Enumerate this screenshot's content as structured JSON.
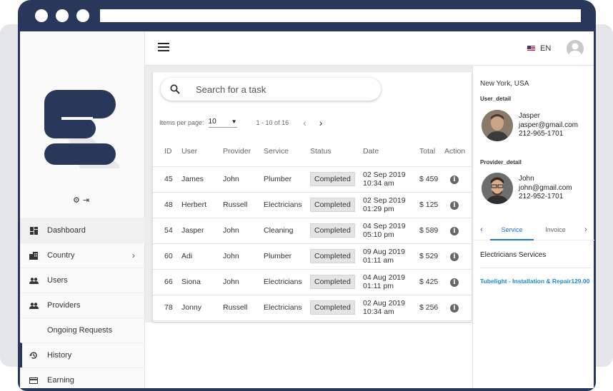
{
  "header": {
    "language": "EN"
  },
  "sidebar": {
    "items": [
      {
        "label": "Dashboard",
        "icon": "dashboard-icon"
      },
      {
        "label": "Country",
        "icon": "building-icon",
        "expandable": true
      },
      {
        "label": "Users",
        "icon": "people-icon"
      },
      {
        "label": "Providers",
        "icon": "people-icon"
      },
      {
        "label": "Ongoing Requests",
        "icon": ""
      },
      {
        "label": "History",
        "icon": "history-icon"
      },
      {
        "label": "Earning",
        "icon": "card-icon"
      }
    ]
  },
  "search": {
    "placeholder": "Search for a task"
  },
  "pager": {
    "items_per_page_label": "Items per page:",
    "per_page": "10",
    "range": "1 - 10 of 16"
  },
  "table": {
    "headers": [
      "ID",
      "User",
      "Provider",
      "Service",
      "Status",
      "Date",
      "Total",
      "Action"
    ],
    "rows": [
      {
        "id": "45",
        "user": "James",
        "provider": "John",
        "service": "Plumber",
        "status": "Completed",
        "date": "02 Sep 2019",
        "time": "10:34 am",
        "total": "$ 459"
      },
      {
        "id": "48",
        "user": "Herbert",
        "provider": "Russell",
        "service": "Electricians",
        "status": "Completed",
        "date": "02 Sep 2019",
        "time": "01:29 pm",
        "total": "$ 125"
      },
      {
        "id": "54",
        "user": "Jasper",
        "provider": "John",
        "service": "Cleaning",
        "status": "Completed",
        "date": "04 Sep 2019",
        "time": "05:10 pm",
        "total": "$ 589"
      },
      {
        "id": "60",
        "user": "Adi",
        "provider": "John",
        "service": "Plumber",
        "status": "Completed",
        "date": "09 Aug 2019",
        "time": "01:11 am",
        "total": "$ 529"
      },
      {
        "id": "66",
        "user": "Siona",
        "provider": "John",
        "service": "Electricians",
        "status": "Completed",
        "date": "04 Aug 2019",
        "time": "01:11 pm",
        "total": "$ 425"
      },
      {
        "id": "78",
        "user": "Jonny",
        "provider": "Russell",
        "service": "Electricians",
        "status": "Completed",
        "date": "02 Aug 2019",
        "time": "10:34 am",
        "total": "$ 256"
      }
    ]
  },
  "detail": {
    "location": "New York, USA",
    "user_label": "User_detail",
    "user": {
      "name": "Jasper",
      "email": "jasper@gmail.com",
      "phone": "212-965-1701"
    },
    "provider_label": "Provider_detail",
    "provider": {
      "name": "John",
      "email": "john@gmail.com",
      "phone": "212-952-1701"
    },
    "tabs": [
      "Service",
      "Invoice"
    ],
    "service_title": "Electricians Services",
    "service_item": "Tubelight - Installation & Repair129.00"
  },
  "colors": {
    "frame": "#28375a",
    "accent": "#1a73e8",
    "link": "#1a8ad4"
  }
}
